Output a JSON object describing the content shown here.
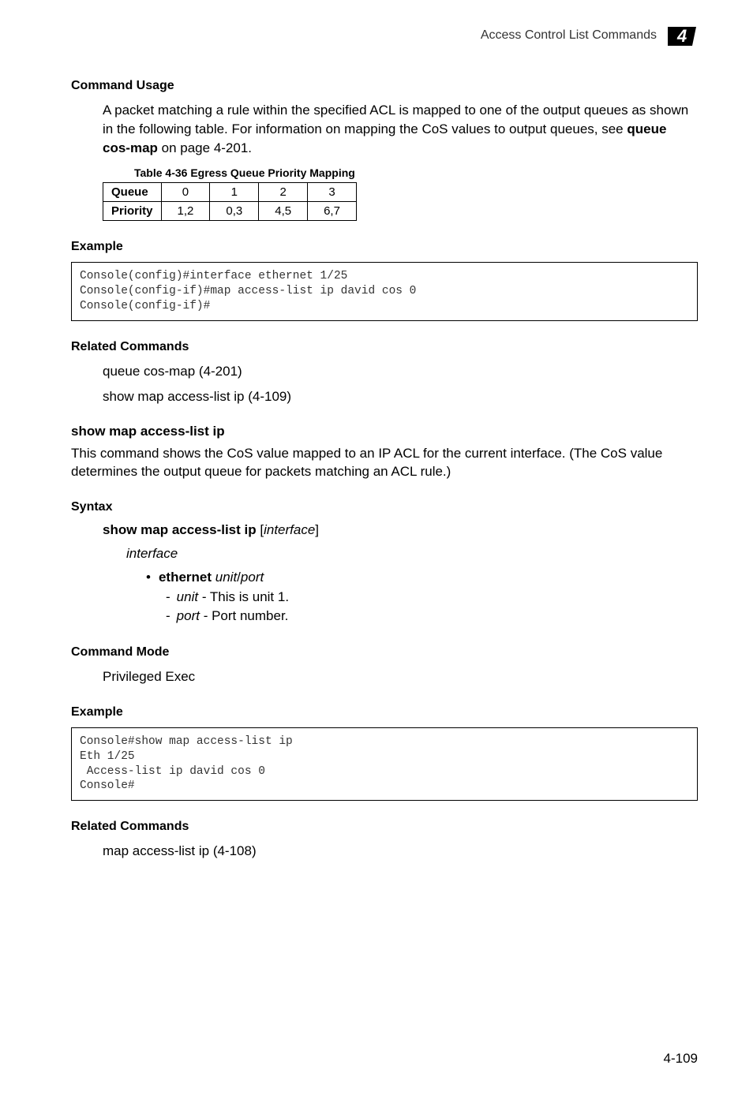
{
  "header": {
    "title": "Access Control List Commands",
    "chapter_number": "4"
  },
  "sections": {
    "command_usage": {
      "heading": "Command Usage",
      "text": "A packet matching a rule within the specified ACL is mapped to one of the output queues as shown in the following table. For information on mapping the CoS values to output queues, see ",
      "link_text": "queue cos-map",
      "text_after": " on page 4-201."
    },
    "table": {
      "caption": "Table 4-36  Egress Queue Priority Mapping",
      "headers": [
        "Queue",
        "0",
        "1",
        "2",
        "3"
      ],
      "row_label": "Priority",
      "row_values": [
        "1,2",
        "0,3",
        "4,5",
        "6,7"
      ]
    },
    "example1": {
      "heading": "Example",
      "code": "Console(config)#interface ethernet 1/25\nConsole(config-if)#map access-list ip david cos 0\nConsole(config-if)#"
    },
    "related1": {
      "heading": "Related Commands",
      "line1": "queue cos-map (4-201)",
      "line2": "show map access-list ip (4-109)"
    },
    "show_map": {
      "heading": "show map access-list ip",
      "text": "This command shows the CoS value mapped to an IP ACL for the current interface. (The CoS value determines the output queue for packets matching an ACL rule.)"
    },
    "syntax": {
      "heading": "Syntax",
      "cmd_bold": "show map access-list ip ",
      "cmd_bracket_open": "[",
      "cmd_italic": "interface",
      "cmd_bracket_close": "]",
      "interface_label": "interface",
      "ethernet_label": "ethernet",
      "ethernet_args": " unit",
      "ethernet_slash": "/",
      "ethernet_port": "port",
      "unit_label": "unit",
      "unit_text": " - This is unit 1.",
      "port_label": "port",
      "port_text": " - Port number."
    },
    "command_mode": {
      "heading": "Command Mode",
      "text": "Privileged Exec"
    },
    "example2": {
      "heading": "Example",
      "code": "Console#show map access-list ip\nEth 1/25\n Access-list ip david cos 0\nConsole#"
    },
    "related2": {
      "heading": "Related Commands",
      "line1": "map access-list ip (4-108)"
    }
  },
  "page_number": "4-109"
}
